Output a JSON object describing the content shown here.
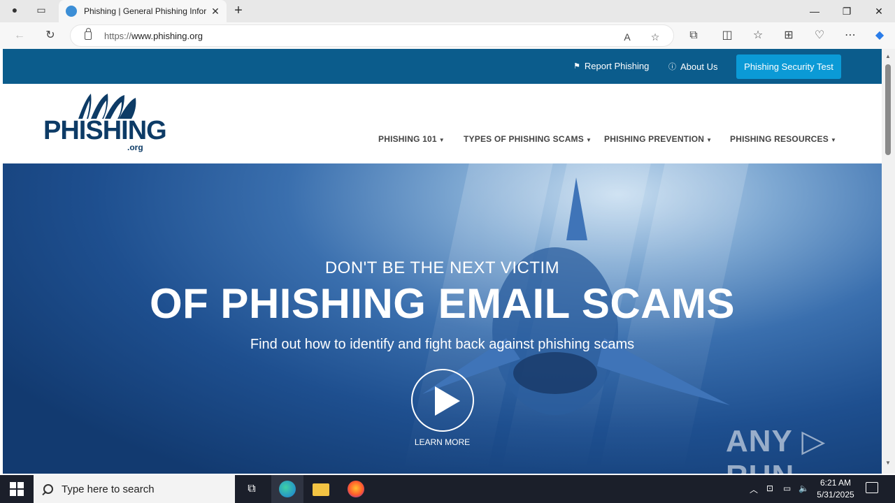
{
  "browser": {
    "tab_title": "Phishing | General Phishing Information",
    "tab_close": "✕",
    "new_tab": "+",
    "url_protocol": "https://",
    "url_host": "www.phishing.org",
    "window_controls": {
      "minimize": "—",
      "restore": "❐",
      "close": "✕"
    }
  },
  "site": {
    "top_links": {
      "report": "Report Phishing",
      "about": "About Us",
      "test_button": "Phishing Security Test"
    },
    "logo": {
      "word": "PHISHING",
      "suffix": ".org"
    },
    "nav": [
      {
        "label": "PHISHING 101"
      },
      {
        "label": "TYPES OF PHISHING SCAMS"
      },
      {
        "label": "PHISHING PREVENTION"
      },
      {
        "label": "PHISHING RESOURCES"
      }
    ],
    "hero": {
      "kicker": "DON'T BE THE NEXT VICTIM",
      "title": "OF PHISHING EMAIL SCAMS",
      "subtitle": "Find out how to identify and fight back against phishing scams",
      "cta": "LEARN MORE"
    },
    "watermark": "ANY ▷ RUN"
  },
  "taskbar": {
    "search_placeholder": "Type here to search",
    "time": "6:21 AM",
    "date": "5/31/2025"
  },
  "colors": {
    "top_strip": "#0b5c8c",
    "test_button": "#0b9ad6",
    "logo": "#0d3b66"
  }
}
